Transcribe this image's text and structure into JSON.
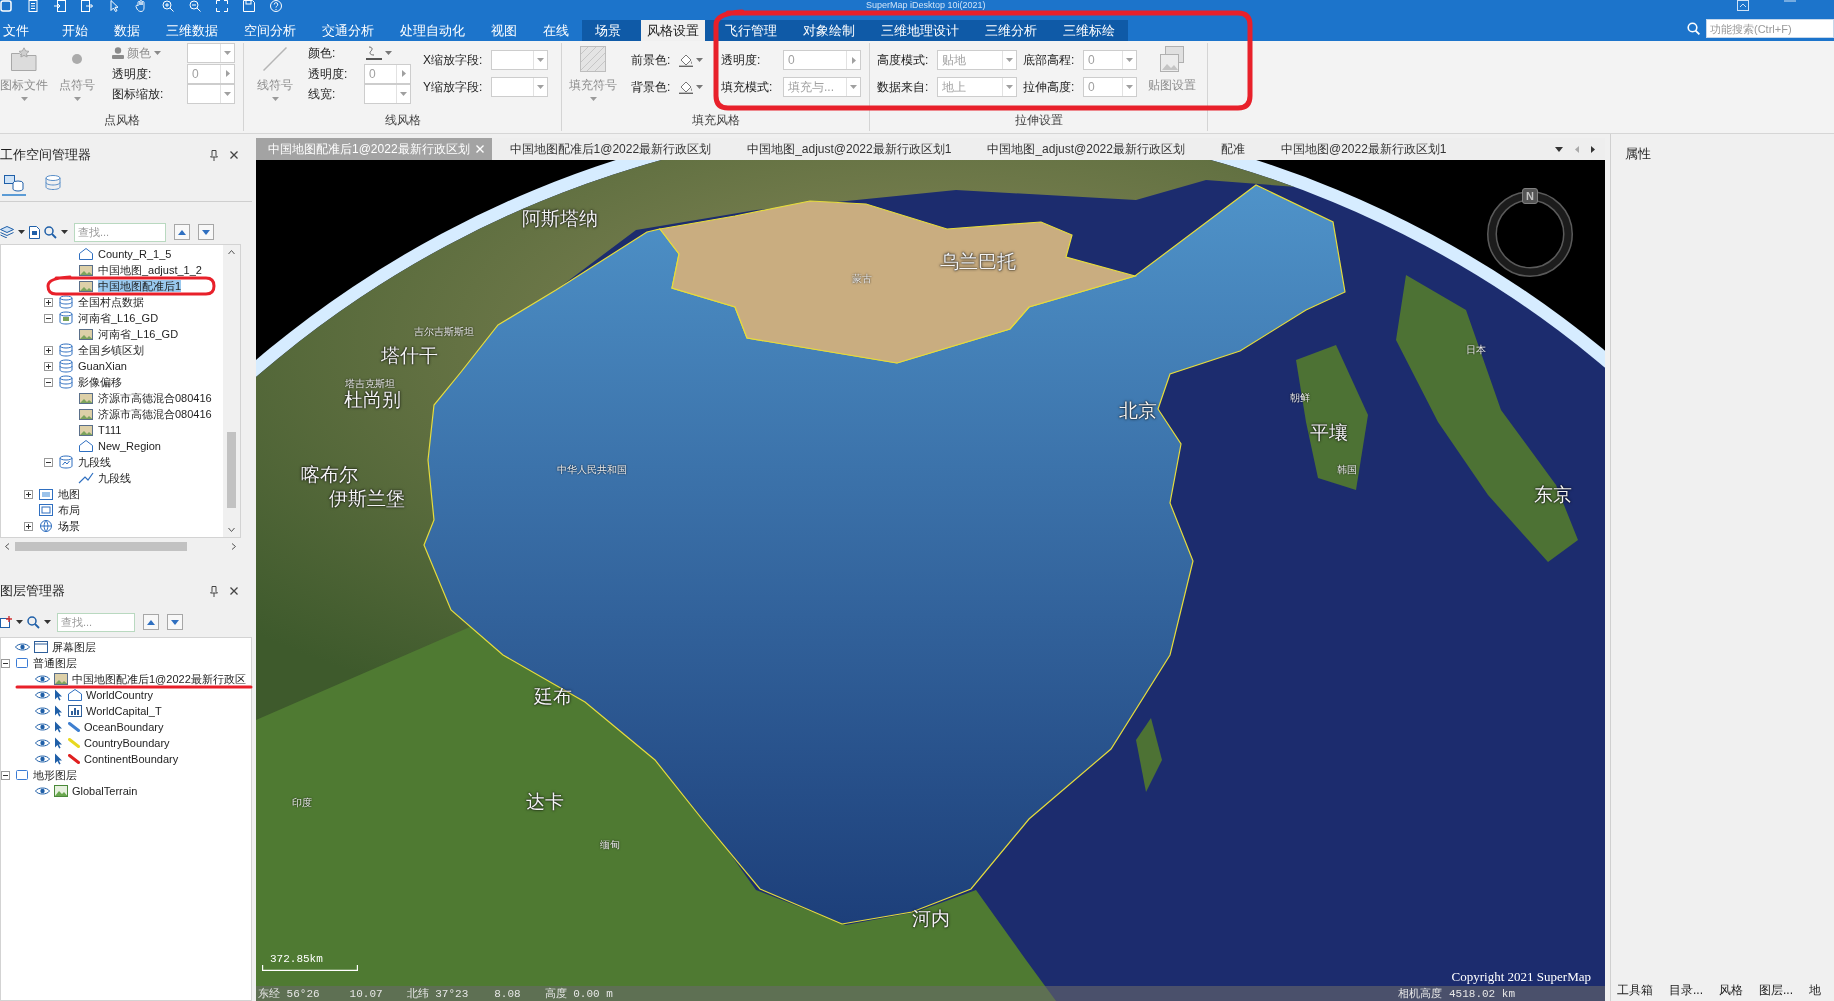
{
  "window": {
    "title": "SuperMap iDesktop 10i(2021)"
  },
  "menu_tabs": [
    {
      "label": "文件",
      "selected": false,
      "contextual": false
    },
    {
      "label": "开始",
      "selected": false,
      "contextual": false
    },
    {
      "label": "数据",
      "selected": false,
      "contextual": false
    },
    {
      "label": "三维数据",
      "selected": false,
      "contextual": false
    },
    {
      "label": "空间分析",
      "selected": false,
      "contextual": false
    },
    {
      "label": "交通分析",
      "selected": false,
      "contextual": false
    },
    {
      "label": "处理自动化",
      "selected": false,
      "contextual": false
    },
    {
      "label": "视图",
      "selected": false,
      "contextual": false
    },
    {
      "label": "在线",
      "selected": false,
      "contextual": false
    },
    {
      "label": "场景",
      "selected": false,
      "contextual": true
    },
    {
      "label": "风格设置",
      "selected": true,
      "contextual": true
    },
    {
      "label": "飞行管理",
      "selected": false,
      "contextual": true
    },
    {
      "label": "对象绘制",
      "selected": false,
      "contextual": true
    },
    {
      "label": "三维地理设计",
      "selected": false,
      "contextual": true
    },
    {
      "label": "三维分析",
      "selected": false,
      "contextual": true
    },
    {
      "label": "三维标绘",
      "selected": false,
      "contextual": true
    }
  ],
  "feature_search": {
    "placeholder": "功能搜索(Ctrl+F)"
  },
  "ribbon": {
    "groups": [
      {
        "label": "点风格",
        "columns": [
          {
            "kind": "large_button",
            "label": "图标文件",
            "disabled": true,
            "dropdown": true
          },
          {
            "kind": "large_button",
            "label": "点符号",
            "disabled": true,
            "dropdown": true
          },
          {
            "kind": "rows",
            "rows": [
              {
                "label": "颜色",
                "label_dropdown": true,
                "control": {
                  "kind": "combo"
                }
              },
              {
                "label": "透明度:",
                "label_dropdown": false,
                "control": {
                  "kind": "spin",
                  "value": "0"
                }
              },
              {
                "label": "图标缩放:",
                "label_dropdown": false,
                "control": {
                  "kind": "combo"
                }
              }
            ]
          }
        ]
      },
      {
        "label": "线风格",
        "columns": [
          {
            "kind": "large_button",
            "label": "线符号",
            "disabled": true,
            "dropdown": true
          },
          {
            "kind": "rows",
            "rows": [
              {
                "label": "颜色:",
                "label_dropdown": false,
                "control": {
                  "kind": "color"
                }
              },
              {
                "label": "透明度:",
                "label_dropdown": false,
                "control": {
                  "kind": "spin",
                  "value": "0"
                }
              },
              {
                "label": "线宽:",
                "label_dropdown": false,
                "control": {
                  "kind": "combo"
                }
              }
            ]
          },
          {
            "kind": "rows",
            "rows": [
              {
                "label": "X缩放字段:",
                "label_dropdown": false,
                "control": {
                  "kind": "combo"
                }
              },
              {
                "label": "Y缩放字段:",
                "label_dropdown": false,
                "control": {
                  "kind": "combo"
                }
              }
            ]
          }
        ]
      },
      {
        "label": "填充风格",
        "columns": [
          {
            "kind": "large_button",
            "label": "填充符号",
            "disabled": true,
            "dropdown": true
          },
          {
            "kind": "rows",
            "rows": [
              {
                "label": "前景色:",
                "label_dropdown": false,
                "control": {
                  "kind": "color"
                }
              },
              {
                "label": "背景色:",
                "label_dropdown": false,
                "control": {
                  "kind": "color"
                }
              }
            ]
          },
          {
            "kind": "rows",
            "rows": [
              {
                "label": "透明度:",
                "label_dropdown": false,
                "control": {
                  "kind": "spin",
                  "value": "0"
                }
              },
              {
                "label": "填充模式:",
                "label_dropdown": false,
                "control": {
                  "kind": "combo",
                  "value": "填充与..."
                }
              }
            ]
          }
        ]
      },
      {
        "label": "拉伸设置",
        "columns": [
          {
            "kind": "rows",
            "rows": [
              {
                "label": "高度模式:",
                "label_dropdown": false,
                "control": {
                  "kind": "combo",
                  "value": "贴地"
                }
              },
              {
                "label": "数据来自:",
                "label_dropdown": false,
                "control": {
                  "kind": "combo",
                  "value": "地上"
                }
              }
            ]
          },
          {
            "kind": "rows",
            "rows": [
              {
                "label": "底部高程:",
                "label_dropdown": false,
                "control": {
                  "kind": "combo",
                  "value": "0"
                }
              },
              {
                "label": "拉伸高度:",
                "label_dropdown": false,
                "control": {
                  "kind": "combo",
                  "value": "0"
                }
              }
            ]
          },
          {
            "kind": "large_button",
            "label": "贴图设置",
            "disabled": true,
            "dropdown": false
          }
        ]
      }
    ]
  },
  "document_tabs": [
    {
      "label": "中国地图配准后1@2022最新行政区划",
      "selected": true
    },
    {
      "label": "中国地图配准后1@2022最新行政区划",
      "selected": false
    },
    {
      "label": "中国地图_adjust@2022最新行政区划1",
      "selected": false
    },
    {
      "label": "中国地图_adjust@2022最新行政区划",
      "selected": false
    },
    {
      "label": "配准",
      "selected": false
    },
    {
      "label": "中国地图@2022最新行政区划1",
      "selected": false
    }
  ],
  "workspace_manager": {
    "title": "工作空间管理器",
    "view_tabs": [
      {
        "selected": true
      },
      {
        "selected": false
      }
    ],
    "search": {
      "placeholder": "查找..."
    },
    "tree": [
      {
        "children": [
          {
            "children": [
              {
                "children": [
                  {
                    "label": "County_R_1_5",
                    "kind": "region",
                    "selected": false
                  },
                  {
                    "label": "中国地图_adjust_1_2",
                    "kind": "raster",
                    "selected": false
                  },
                  {
                    "label": "中国地图配准后1",
                    "kind": "raster",
                    "selected": true
                  }
                ]
              },
              {
                "label": "全国村点数据",
                "kind": "udb",
                "expanded": false,
                "selected": false
              },
              {
                "label": "河南省_L16_GD",
                "kind": "img",
                "expanded": true,
                "selected": false,
                "children": [
                  {
                    "label": "河南省_L16_GD",
                    "kind": "raster",
                    "selected": false
                  }
                ]
              },
              {
                "label": "全国乡镇区划",
                "kind": "udb",
                "expanded": false,
                "selected": false
              },
              {
                "label": "GuanXian",
                "kind": "udb",
                "expanded": false,
                "selected": false
              },
              {
                "label": "影像偏移",
                "kind": "udb",
                "expanded": true,
                "selected": false,
                "children": [
                  {
                    "label": "济源市高德混合080416",
                    "kind": "raster",
                    "selected": false
                  },
                  {
                    "label": "济源市高德混合080416",
                    "kind": "raster",
                    "selected": false
                  },
                  {
                    "label": "T111",
                    "kind": "raster",
                    "selected": false
                  },
                  {
                    "label": "New_Region",
                    "kind": "region",
                    "selected": false
                  }
                ]
              },
              {
                "label": "九段线",
                "kind": "vec",
                "expanded": true,
                "selected": false,
                "children": [
                  {
                    "label": "九段线",
                    "kind": "line",
                    "selected": false
                  }
                ]
              }
            ]
          },
          {
            "label": "地图",
            "kind": "maps",
            "expanded": false,
            "selected": false
          },
          {
            "label": "布局",
            "kind": "layouts",
            "selected": false
          },
          {
            "label": "场景",
            "kind": "scenes",
            "expanded": false,
            "selected": false
          }
        ]
      }
    ]
  },
  "layer_manager": {
    "title": "图层管理器",
    "search": {
      "placeholder": "查找..."
    },
    "tree": [
      {
        "label": "屏幕图层",
        "kind": "screen",
        "visible": true,
        "selected": false
      },
      {
        "label": "普通图层",
        "kind": "group",
        "expanded": true,
        "selected": false,
        "children": [
          {
            "label": "中国地图配准后1@2022最新行政区",
            "kind": "raster",
            "visible": true,
            "selected": false
          },
          {
            "label": "WorldCountry",
            "kind": "region",
            "visible": true,
            "selectable": true,
            "selected": false
          },
          {
            "label": "WorldCapital_T",
            "kind": "point_theme",
            "visible": true,
            "selectable": true,
            "selected": false
          },
          {
            "label": "OceanBoundary",
            "kind": "line",
            "visible": true,
            "selectable": true,
            "selected": false,
            "color": "#3f7fd0"
          },
          {
            "label": "CountryBoundary",
            "kind": "line",
            "visible": true,
            "selectable": true,
            "selected": false,
            "color": "#e8d820"
          },
          {
            "label": "ContinentBoundary",
            "kind": "line",
            "visible": true,
            "selectable": true,
            "selected": false,
            "color": "#e02020"
          }
        ]
      },
      {
        "label": "地形图层",
        "kind": "group",
        "expanded": true,
        "selected": false,
        "children": [
          {
            "label": "GlobalTerrain",
            "kind": "terrain",
            "visible": true,
            "selected": false
          }
        ]
      }
    ]
  },
  "scene": {
    "labels": [
      {
        "text": "阿斯塔纳",
        "kind": "city"
      },
      {
        "text": "乌兰巴托",
        "kind": "city"
      },
      {
        "text": "塔什干",
        "kind": "city"
      },
      {
        "text": "杜尚别",
        "kind": "city"
      },
      {
        "text": "喀布尔",
        "kind": "city"
      },
      {
        "text": "伊斯兰堡",
        "kind": "city"
      },
      {
        "text": "北京",
        "kind": "city"
      },
      {
        "text": "平壤",
        "kind": "city"
      },
      {
        "text": "东京",
        "kind": "city"
      },
      {
        "text": "廷布",
        "kind": "city"
      },
      {
        "text": "达卡",
        "kind": "city"
      },
      {
        "text": "河内",
        "kind": "city"
      },
      {
        "text": "蒙古",
        "kind": "country"
      },
      {
        "text": "中华人民共和国",
        "kind": "country"
      },
      {
        "text": "吉尔吉斯斯坦",
        "kind": "country"
      },
      {
        "text": "塔吉克斯坦",
        "kind": "country"
      },
      {
        "text": "朝鲜",
        "kind": "country"
      },
      {
        "text": "韩国",
        "kind": "country"
      },
      {
        "text": "日本",
        "kind": "country"
      },
      {
        "text": "印度",
        "kind": "country"
      },
      {
        "text": "缅甸",
        "kind": "country"
      }
    ],
    "compass": {
      "north": "N"
    },
    "scale_bar": {
      "text": "372.85km"
    },
    "copyright": "Copyright 2021 SuperMap",
    "status": {
      "longitude": "东经 56°26",
      "longitude_seconds": "10.07",
      "latitude": "北纬 37°23",
      "latitude_seconds": "8.08",
      "altitude": "高度 0.00 m",
      "camera_height": "相机高度 4518.02 km"
    }
  },
  "properties_panel": {
    "title": "属性"
  },
  "dock_tabs": [
    {
      "label": "工具箱",
      "selected": false
    },
    {
      "label": "目录...",
      "selected": false
    },
    {
      "label": "风格",
      "selected": false
    },
    {
      "label": "图层...",
      "selected": false
    },
    {
      "label": "地",
      "selected": false
    }
  ],
  "markups": [
    {
      "kind": "ellipse"
    },
    {
      "kind": "ellipse"
    },
    {
      "kind": "underline"
    }
  ]
}
